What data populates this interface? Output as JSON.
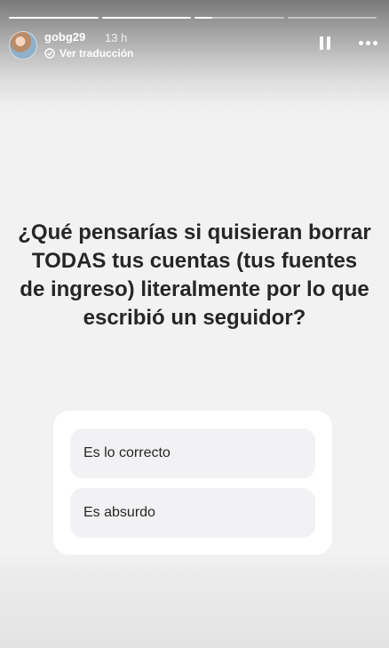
{
  "story": {
    "username": "gobg29",
    "time": "13 h",
    "translate_label": "Ver traducción",
    "progress": [
      1,
      1,
      0.2,
      0
    ]
  },
  "question": {
    "text": "¿Qué pensarías si quisieran borrar TODAS tus cuentas (tus fuentes de ingreso) literalmente por lo que escribió un seguidor?"
  },
  "poll": {
    "options": [
      {
        "label": "Es lo correcto"
      },
      {
        "label": "Es absurdo"
      }
    ]
  },
  "icons": {
    "translate": "translate-icon",
    "pause": "pause-icon",
    "more": "more-icon"
  }
}
